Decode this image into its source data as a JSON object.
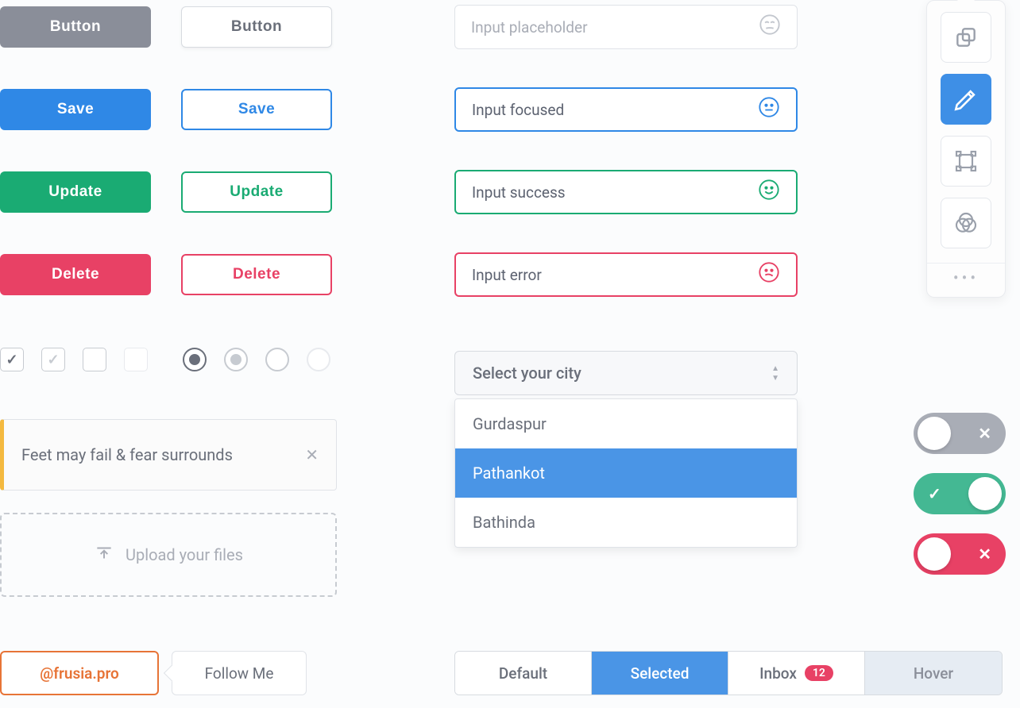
{
  "buttons": {
    "neutral": "Button",
    "save": "Save",
    "update": "Update",
    "delete": "Delete"
  },
  "inputs": {
    "placeholder": "Input placeholder",
    "focused": "Input focused",
    "success": "Input success",
    "error": "Input error"
  },
  "alert": {
    "text": "Feet may fail & fear surrounds"
  },
  "upload": {
    "text": "Upload your files"
  },
  "select": {
    "placeholder": "Select your city",
    "options": [
      "Gurdaspur",
      "Pathankot",
      "Bathinda"
    ],
    "selected_index": 1
  },
  "tabs": {
    "default": "Default",
    "selected": "Selected",
    "inbox": "Inbox",
    "inbox_count": "12",
    "hover": "Hover"
  },
  "promo": {
    "handle": "@frusia.pro",
    "follow": "Follow Me"
  },
  "colors": {
    "blue": "#2f88e6",
    "green": "#1aab73",
    "red": "#e84165",
    "gray": "#8a8e99",
    "orange": "#e77437",
    "amber": "#f4b93f"
  }
}
